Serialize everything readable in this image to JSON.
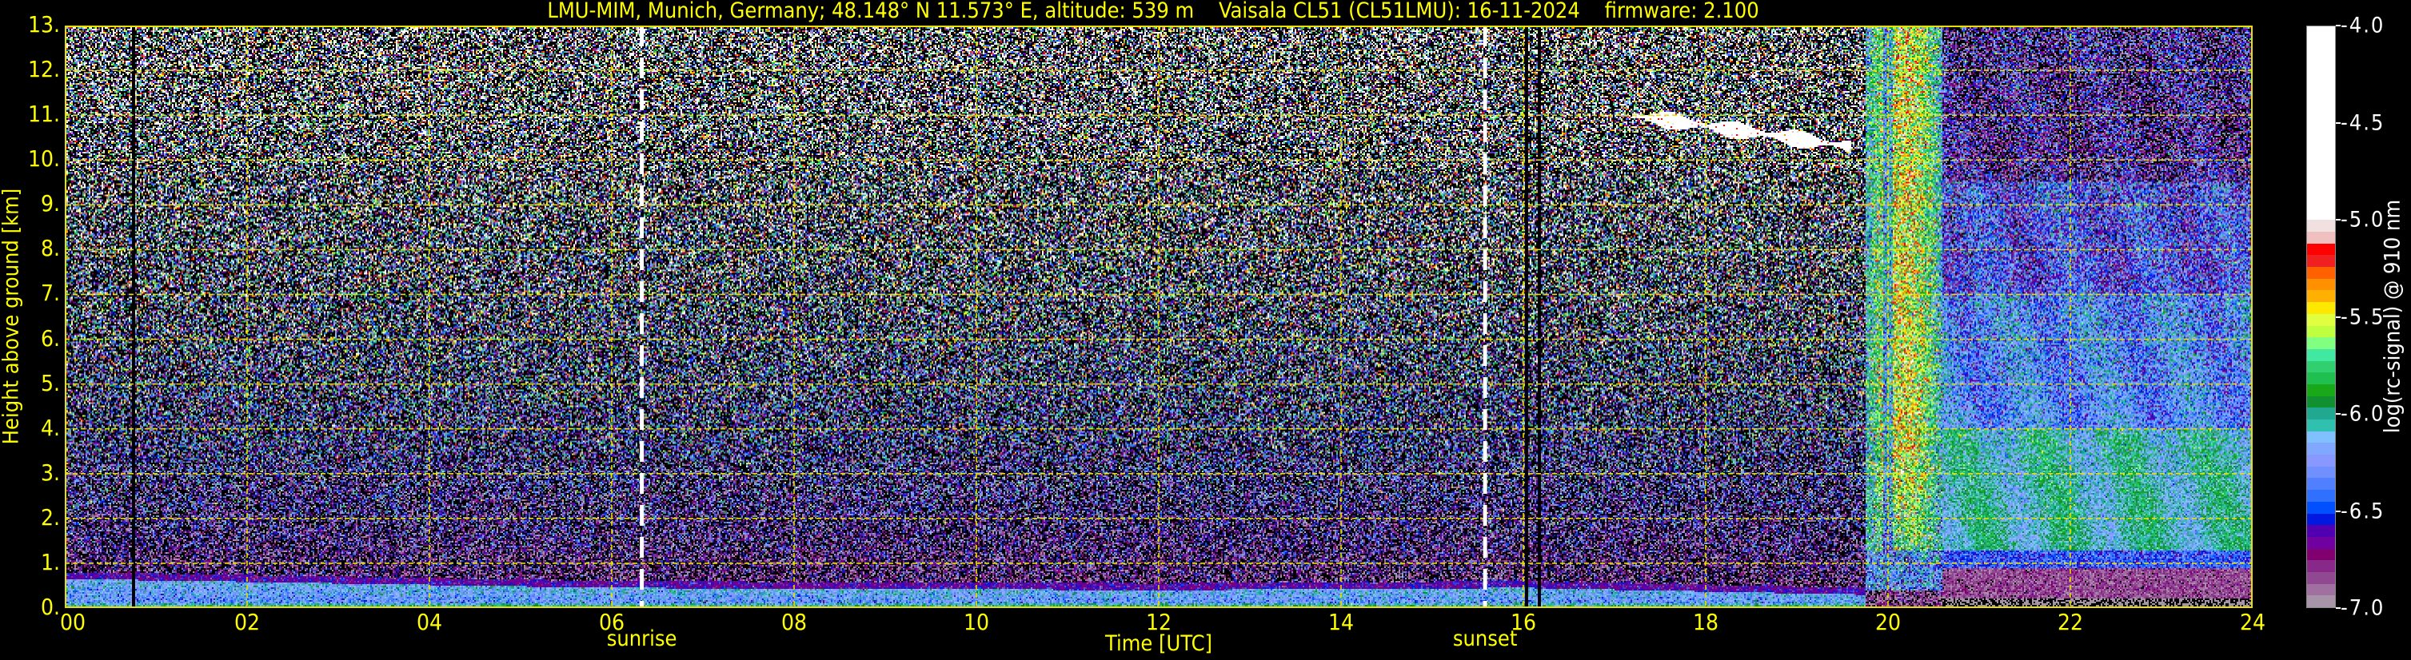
{
  "title": "LMU-MIM, Munich, Germany; 48.148° N 11.573° E, altitude: 539 m    Vaisala CL51 (CL51LMU): 16-11-2024    firmware: 2.100",
  "chart_data": {
    "type": "heatmap",
    "title": "LMU-MIM, Munich, Germany; 48.148° N 11.573° E, altitude: 539 m    Vaisala CL51 (CL51LMU): 16-11-2024    firmware: 2.100",
    "xlabel": "Time [UTC]",
    "ylabel": "Height above ground [km]",
    "xlim": [
      0,
      24
    ],
    "ylim": [
      0,
      13
    ],
    "xticks": [
      "00",
      "02",
      "04",
      "06",
      "08",
      "10",
      "12",
      "14",
      "16",
      "18",
      "20",
      "22",
      "24"
    ],
    "xtick_values": [
      0,
      2,
      4,
      6,
      8,
      10,
      12,
      14,
      16,
      18,
      20,
      22,
      24
    ],
    "yticks": [
      "0.",
      "1.",
      "2.",
      "3.",
      "4.",
      "5.",
      "6.",
      "7.",
      "8.",
      "9.",
      "10.",
      "11.",
      "12.",
      "13."
    ],
    "ytick_values": [
      0,
      1,
      2,
      3,
      4,
      5,
      6,
      7,
      8,
      9,
      10,
      11,
      12,
      13
    ],
    "grid": true,
    "annotations": [
      {
        "label": "sunrise",
        "time_h": 6.33
      },
      {
        "label": "sunset",
        "time_h": 15.58
      }
    ],
    "colorbar": {
      "label": "log(rc-signal) @ 910 nm",
      "range": [
        -7.0,
        -4.0
      ],
      "ticks": [
        "-4.0",
        "-4.5",
        "-5.0",
        "-5.5",
        "-6.0",
        "-6.5",
        "-7.0"
      ],
      "tick_values": [
        -4.0,
        -4.5,
        -5.0,
        -5.5,
        -6.0,
        -6.5,
        -7.0
      ],
      "colors_low_to_high": [
        "#a894a8",
        "#a070a0",
        "#904890",
        "#882888",
        "#800070",
        "#7000a0",
        "#5000b0",
        "#0018e0",
        "#0050ff",
        "#3070ff",
        "#5080ff",
        "#7090ff",
        "#8898ff",
        "#80a8ff",
        "#80c0ff",
        "#30c0b0",
        "#20a890",
        "#109030",
        "#18a818",
        "#20c050",
        "#30d070",
        "#40e8a0",
        "#80ff80",
        "#c0ff40",
        "#e0ff40",
        "#ffe800",
        "#ffb000",
        "#ff9000",
        "#ff6000",
        "#f02020",
        "#ff0000",
        "#f0c0c0",
        "#f0e0e0"
      ],
      "saturated_color": "#ffffff",
      "saturation_level": -5.0
    },
    "features": {
      "boundary_layer_top_km": {
        "t": [
          0,
          6,
          12,
          16,
          19.7
        ],
        "h": [
          0.65,
          0.45,
          0.4,
          0.45,
          0.3
        ]
      },
      "cirrus": {
        "t_start": 17.2,
        "t_end": 19.6,
        "h_start": 11.0,
        "h_end": 10.3,
        "level": -4.5
      },
      "precipitation_column": {
        "t_start": 19.75,
        "t_end": 20.6,
        "h_top": 13,
        "level": -5.5
      },
      "post_rain_layers": [
        {
          "h": [
            1.3,
            4.0
          ],
          "level": -6.05
        },
        {
          "h": [
            4.0,
            7.0
          ],
          "level": -6.3
        },
        {
          "h": [
            7.0,
            9.5
          ],
          "level": -6.5
        },
        {
          "h": [
            9.5,
            13.0
          ],
          "level": -6.8
        }
      ],
      "missing_data_times_h": [
        0.76,
        16.04,
        16.17
      ]
    }
  }
}
